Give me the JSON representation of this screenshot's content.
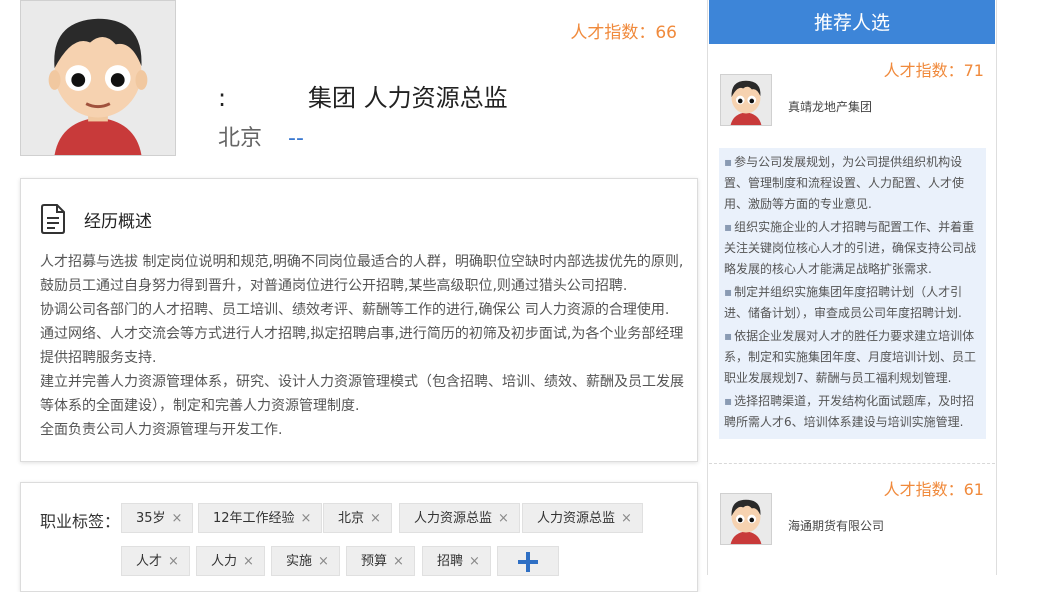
{
  "profile": {
    "talent_index": "人才指数：66",
    "title_tail": "集团 人力资源总监",
    "title_mark": ":",
    "city": "北京",
    "city_link": "--"
  },
  "experience": {
    "heading": "经历概述",
    "paragraphs": [
      "人才招募与选拔 制定岗位说明和规范,明确不同岗位最适合的人群，明确职位空缺时内部选拔优先的原则,鼓励员工通过自身努力得到晋升，对普通岗位进行公开招聘,某些高级职位,则通过猎头公司招聘.",
      "协调公司各部门的人才招聘、员工培训、绩效考评、薪酬等工作的进行,确保公 司人力资源的合理使用.",
      "通过网络、人才交流会等方式进行人才招聘,拟定招聘启事,进行简历的初筛及初步面试,为各个业务部经理提供招聘服务支持.",
      "建立并完善人力资源管理体系，研究、设计人力资源管理模式（包含招聘、培训、绩效、薪酬及员工发展等体系的全面建设），制定和完善人力资源管理制度.",
      "全面负责公司人力资源管理与开发工作."
    ]
  },
  "tags": {
    "label": "职业标签：",
    "items": [
      "35岁",
      "12年工作经验",
      "北京",
      "人力资源总监",
      "人力资源总监",
      "人才",
      "人力",
      "实施",
      "预算",
      "招聘"
    ],
    "remove_symbol": "×"
  },
  "sidebar": {
    "header": "推荐人选",
    "candidates": [
      {
        "talent_index": "人才指数：71",
        "company": "真靖龙地产集团",
        "bullets": [
          "参与公司发展规划，为公司提供组织机构设置、管理制度和流程设置、人力配置、人才使用、激励等方面的专业意见.",
          "组织实施企业的人才招聘与配置工作、并着重关注关键岗位核心人才的引进，确保支持公司战略发展的核心人才能满足战略扩张需求.",
          "制定并组织实施集团年度招聘计划（人才引进、储备计划），审查成员公司年度招聘计划.",
          "依据企业发展对人才的胜任力要求建立培训体系，制定和实施集团年度、月度培训计划、员工职业发展规划7、薪酬与员工福利规划管理.",
          "选择招聘渠道，开发结构化面试题库，及时招聘所需人才6、培训体系建设与培训实施管理."
        ]
      },
      {
        "talent_index": "人才指数：61",
        "company": "海通期货有限公司"
      }
    ]
  },
  "colors": {
    "accent_orange": "#f08a3c",
    "header_blue": "#3d85d8",
    "link_blue": "#3a78d0",
    "desc_bg": "#eaf1fb"
  },
  "icons": {
    "document": "document-icon",
    "remove": "close-icon",
    "add": "plus-icon",
    "avatar": "cartoon-avatar"
  }
}
